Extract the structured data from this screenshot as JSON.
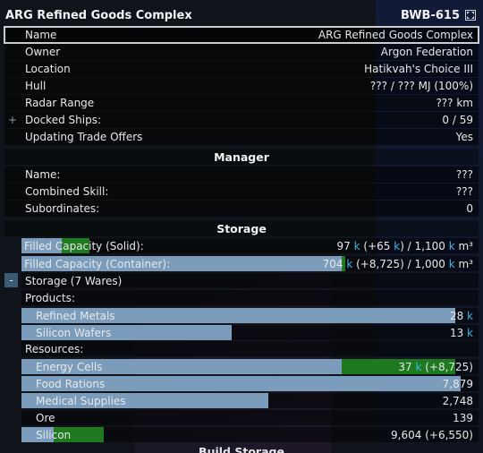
{
  "window": {
    "title": "ARG Refined Goods Complex",
    "code": "BWB-615"
  },
  "info_rows": [
    {
      "label": "Name",
      "value": "ARG Refined Goods Complex"
    },
    {
      "label": "Owner",
      "value": "Argon Federation"
    },
    {
      "label": "Location",
      "value": "Hatikvah's Choice III"
    },
    {
      "label": "Hull",
      "value": "??? / ??? MJ (100%)"
    },
    {
      "label": "Radar Range",
      "value": "??? km"
    },
    {
      "label": "Docked Ships:",
      "value": "0 / 59"
    },
    {
      "label": "Updating Trade Offers",
      "value": "Yes"
    }
  ],
  "manager": {
    "heading": "Manager",
    "rows": [
      {
        "label": "Name:",
        "value": "???"
      },
      {
        "label": "Combined Skill:",
        "value": "???"
      },
      {
        "label": "Subordinates:",
        "value": "0"
      }
    ]
  },
  "storage": {
    "heading": "Storage",
    "capacity": [
      {
        "label": "Filled Capacity (Solid):",
        "num": "97",
        "unit": "k",
        "delta": " (+65 ",
        "delta_unit": "k",
        "rest": ") / 1,100 ",
        "rest_unit": "k",
        "tail": " m³",
        "fill_blue": 0.088,
        "fill_green": 0.06
      },
      {
        "label": "Filled Capacity (Container):",
        "num": "704",
        "unit": "k",
        "delta": " (+8,725) / 1,000 ",
        "delta_unit": "k",
        "rest": "",
        "rest_unit": "",
        "tail": " m³",
        "fill_blue": 0.7,
        "fill_green": 0.009
      }
    ],
    "toggle_label": "Storage (7 Wares)",
    "products_label": "Products:",
    "products": [
      {
        "name": "Refined Metals",
        "num": "28",
        "unit": "k",
        "extra": "",
        "fill_blue": 0.95,
        "fill_green": 0
      },
      {
        "name": "Silicon Wafers",
        "num": "13",
        "unit": "k",
        "extra": "",
        "fill_blue": 0.46,
        "fill_green": 0
      }
    ],
    "resources_label": "Resources:",
    "resources": [
      {
        "name": "Energy Cells",
        "num": "37",
        "unit": "k",
        "extra": " (+8,725)",
        "fill_blue": 0.7,
        "fill_green": 0.25
      },
      {
        "name": "Food Rations",
        "num": "7,879",
        "unit": "",
        "extra": "",
        "fill_blue": 0.96,
        "fill_green": 0
      },
      {
        "name": "Medical Supplies",
        "num": "2,748",
        "unit": "",
        "extra": "",
        "fill_blue": 0.54,
        "fill_green": 0
      },
      {
        "name": "Ore",
        "num": "139",
        "unit": "",
        "extra": "",
        "fill_blue": 0,
        "fill_green": 0
      },
      {
        "name": "Silicon",
        "num": "9,604",
        "unit": "",
        "extra": " (+6,550)",
        "fill_blue": 0.07,
        "fill_green": 0.11
      }
    ]
  },
  "next_heading": "Build Storage",
  "colors": {
    "accent_k": "#39b7e6",
    "bar_blue": "#7b9dbb",
    "bar_green": "#1f7a1f"
  },
  "icons": {
    "expand": "expand-icon",
    "docked_toggle": "plus-icon",
    "storage_toggle": "minus-icon"
  }
}
